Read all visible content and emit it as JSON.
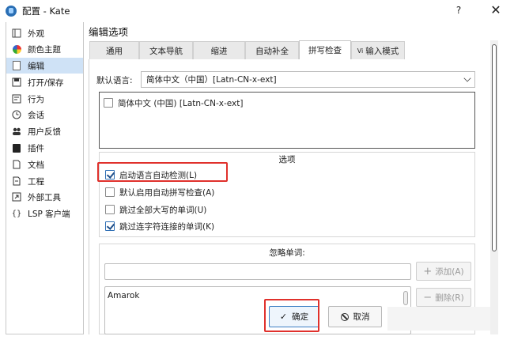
{
  "window": {
    "title": "配置 - Kate",
    "help": "?",
    "close": "✕"
  },
  "sidebar": {
    "items": [
      {
        "label": "外观",
        "icon": "appearance-icon"
      },
      {
        "label": "颜色主题",
        "icon": "palette-icon"
      },
      {
        "label": "编辑",
        "icon": "edit-document-icon",
        "selected": true
      },
      {
        "label": "打开/保存",
        "icon": "document-save-icon"
      },
      {
        "label": "行为",
        "icon": "behavior-icon"
      },
      {
        "label": "会话",
        "icon": "clock-icon"
      },
      {
        "label": "用户反馈",
        "icon": "users-icon"
      },
      {
        "label": "插件",
        "icon": "plugin-icon"
      },
      {
        "label": "文档",
        "icon": "document-icon"
      },
      {
        "label": "工程",
        "icon": "project-icon"
      },
      {
        "label": "外部工具",
        "icon": "external-tools-icon"
      },
      {
        "label": "LSP 客户端",
        "icon": "braces-icon"
      }
    ]
  },
  "main": {
    "title": "编辑选项",
    "tabs": [
      {
        "label": "通用"
      },
      {
        "label": "文本导航"
      },
      {
        "label": "缩进"
      },
      {
        "label": "自动补全"
      },
      {
        "label": "拼写检查",
        "active": true
      },
      {
        "label": "输入模式",
        "prefix": "Vi"
      }
    ],
    "default_language_label": "默认语言:",
    "default_language_value": "简体中文（中国）[Latn-CN-x-ext]",
    "language_list": [
      {
        "label": "简体中文 (中国) [Latn-CN-x-ext]",
        "checked": false
      }
    ],
    "options_title": "选项",
    "options": [
      {
        "label": "启动语言自动检测(L)",
        "checked": true
      },
      {
        "label": "默认启用自动拼写检查(A)",
        "checked": false
      },
      {
        "label": "跳过全部大写的单词(U)",
        "checked": false
      },
      {
        "label": "跳过连字符连接的单词(K)",
        "checked": true
      }
    ],
    "ignore_title": "忽略单词:",
    "ignore_input_value": "",
    "ignore_words": [
      "Amarok"
    ],
    "add_button": "添加(A)",
    "remove_button": "删除(R)"
  },
  "footer": {
    "ok_button": "确定",
    "cancel_button": "取消"
  },
  "colors": {
    "highlight": "#e0312c",
    "selected": "#cfe2f6",
    "accent": "#3d7fc4"
  }
}
